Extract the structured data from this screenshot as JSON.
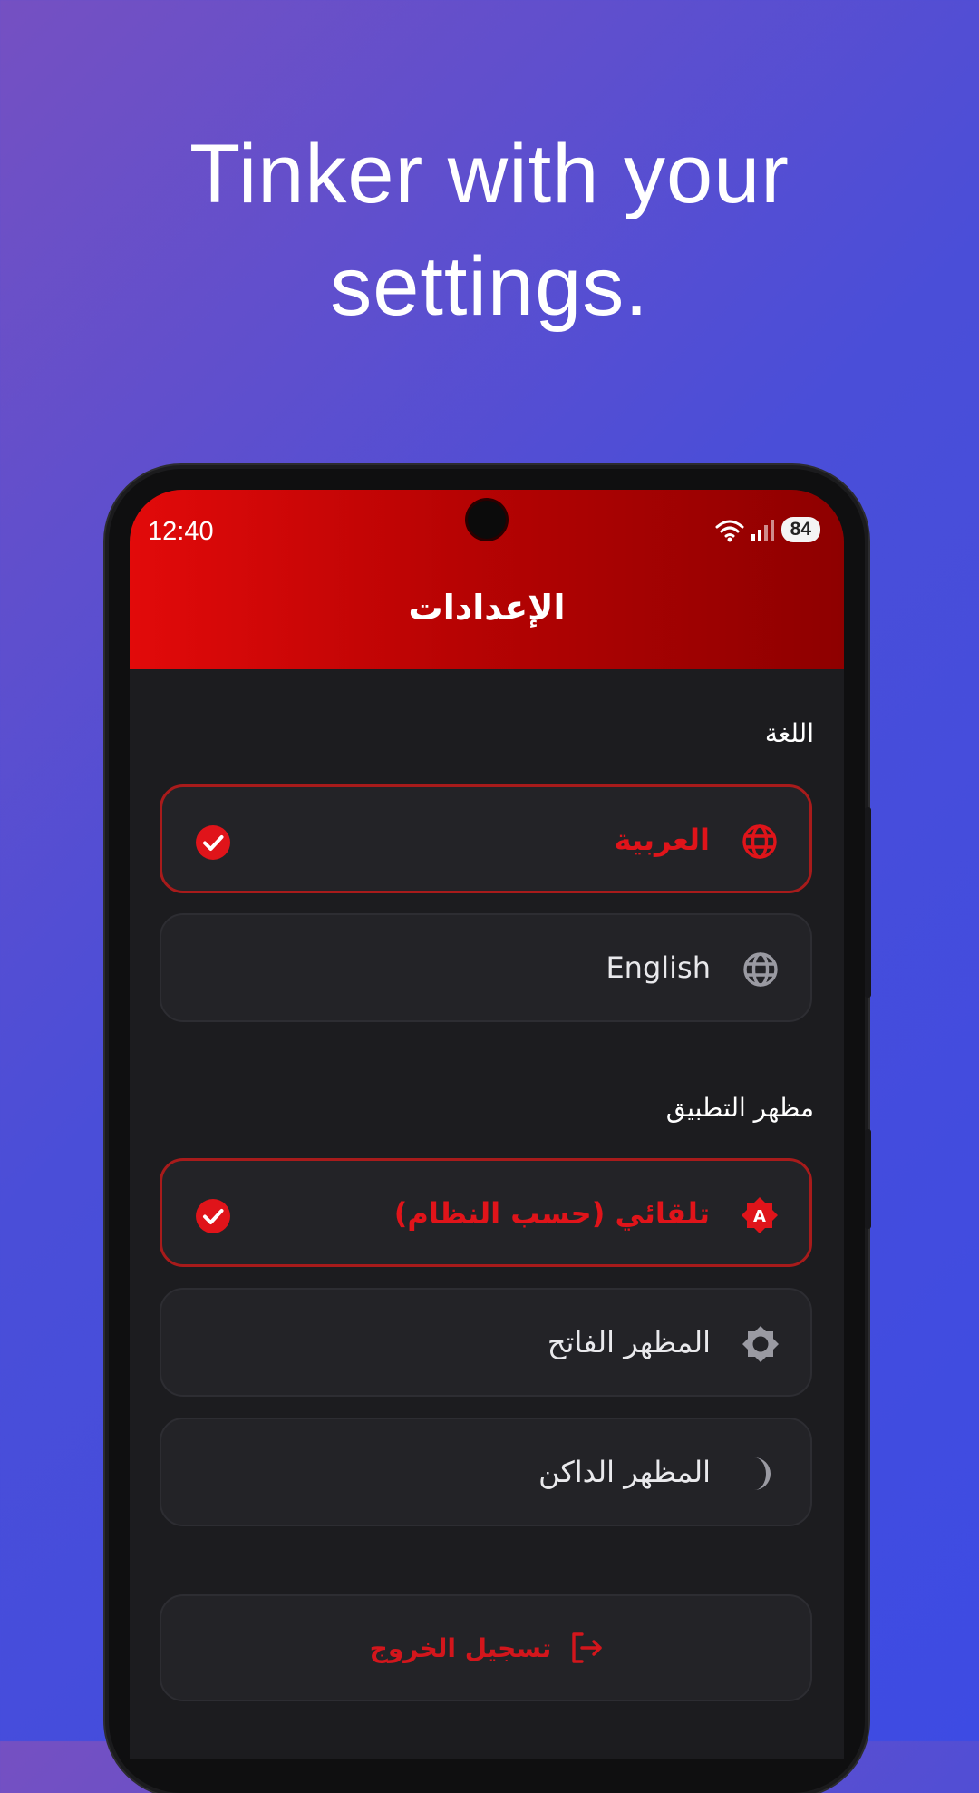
{
  "headline": {
    "line1": "Tinker with your",
    "line2": "settings."
  },
  "status_bar": {
    "time": "12:40",
    "battery": "84"
  },
  "app_bar": {
    "title": "الإعدادات"
  },
  "language_section": {
    "label": "اللغة",
    "options": [
      {
        "label": "العربية",
        "icon": "globe-icon",
        "selected": true
      },
      {
        "label": "English",
        "icon": "globe-icon",
        "selected": false
      }
    ]
  },
  "theme_section": {
    "label": "مظهر التطبيق",
    "options": [
      {
        "label": "تلقائي (حسب النظام)",
        "icon": "brightness-auto-icon",
        "selected": true
      },
      {
        "label": "المظهر الفاتح",
        "icon": "brightness-icon",
        "selected": false
      },
      {
        "label": "المظهر الداكن",
        "icon": "moon-icon",
        "selected": false
      }
    ]
  },
  "logout": {
    "label": "تسجيل الخروج",
    "icon": "logout-icon"
  },
  "colors": {
    "accent_red": "#e0141a",
    "app_bar_start": "#e20a0a",
    "app_bar_end": "#8e0000",
    "surface": "#1c1c1f",
    "card": "#232327",
    "background_start": "#7550c2",
    "background_end": "#3d4be3"
  }
}
